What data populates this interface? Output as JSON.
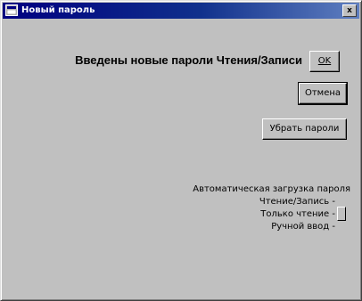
{
  "window": {
    "title": "Новый пароль",
    "close_label": "x"
  },
  "message": "Введены новые пароли Чтения/Записи",
  "buttons": {
    "ok_label": "OK",
    "cancel_label": "Отмена",
    "remove_label": "Убрать пароли"
  },
  "autoload": {
    "label": "Автоматическая загрузка пароля",
    "options": [
      {
        "label": "Чтение/Запись -"
      },
      {
        "label": "Только чтение -"
      },
      {
        "label": "Ручной ввод -"
      }
    ],
    "selected_option": "Только чтение -"
  },
  "colors": {
    "window_bg": "#c0c0c0",
    "titlebar_start": "#000080",
    "titlebar_end": "#5f7fc0"
  }
}
